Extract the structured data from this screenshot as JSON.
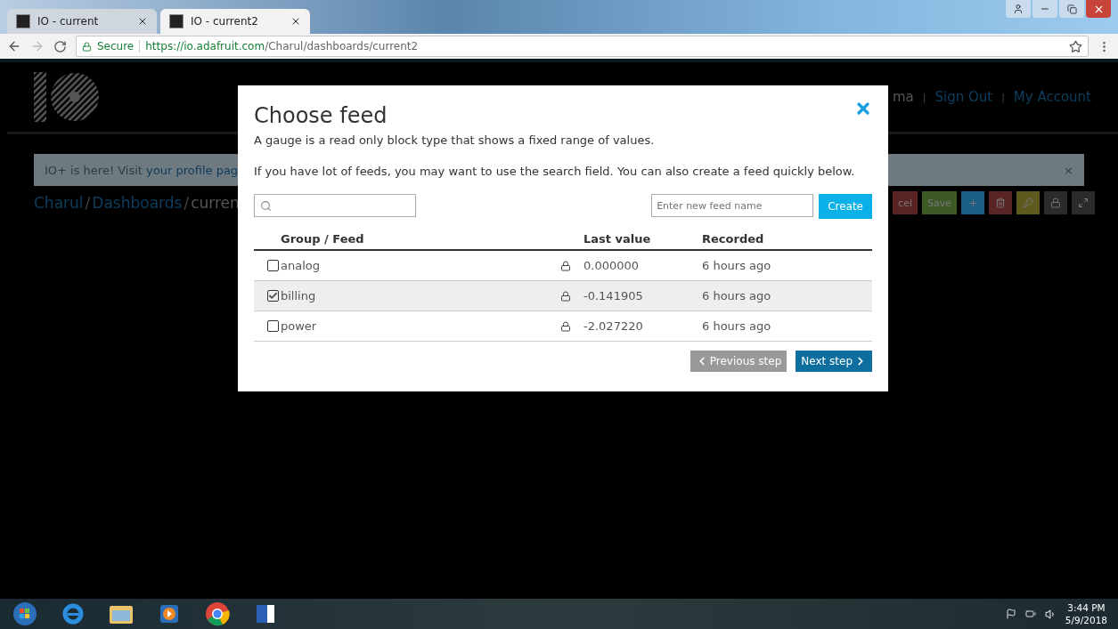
{
  "browser": {
    "tabs": [
      {
        "title": "IO - current",
        "selected": false
      },
      {
        "title": "IO - current2",
        "selected": true
      }
    ],
    "secure_label": "Secure",
    "url_host": "https://io.adafruit.com",
    "url_path": "/Charul/dashboards/current2"
  },
  "page": {
    "nav": [
      "ma",
      "Sign Out",
      "My Account"
    ],
    "nav_separator": "|",
    "breadcrumb_separator": "/",
    "banner": {
      "text": "IO+ is here! Visit ",
      "link": "your profile pag",
      "close": "×"
    },
    "breadcrumb": [
      {
        "label": "Charul",
        "link": true
      },
      {
        "label": "Dashboards",
        "link": true
      },
      {
        "label": "curren",
        "link": false
      }
    ],
    "toolbar": [
      {
        "kind": "text",
        "label": "cel",
        "color": "#5a2424"
      },
      {
        "kind": "text",
        "label": "Save",
        "color": "#3d5a26"
      },
      {
        "kind": "plus",
        "color": "#1c5f86"
      },
      {
        "kind": "trash",
        "color": "#5a2424"
      },
      {
        "kind": "key",
        "color": "#5e5a1e"
      },
      {
        "kind": "lock",
        "color": "#2b2b2b"
      },
      {
        "kind": "expand",
        "color": "#2b2b2b"
      }
    ]
  },
  "modal": {
    "title": "Choose feed",
    "description": "A gauge is a read only block type that shows a fixed range of values.",
    "hint": "If you have lot of feeds, you may want to use the search field. You can also create a feed quickly below.",
    "new_feed": {
      "placeholder": "Enter new feed name"
    },
    "create_button": "Create",
    "columns": [
      "Group / Feed",
      "Last value",
      "Recorded"
    ],
    "rows": [
      {
        "feed": "analog",
        "checked": false,
        "last_value": "0.000000",
        "recorded": "6 hours ago"
      },
      {
        "feed": "billing",
        "checked": true,
        "last_value": "-0.141905",
        "recorded": "6 hours ago"
      },
      {
        "feed": "power",
        "checked": false,
        "last_value": "-2.027220",
        "recorded": "6 hours ago"
      }
    ],
    "previous_button": "Previous step",
    "next_button": "Next step"
  },
  "taskbar": {
    "time": "3:44 PM",
    "date": "5/9/2018"
  }
}
